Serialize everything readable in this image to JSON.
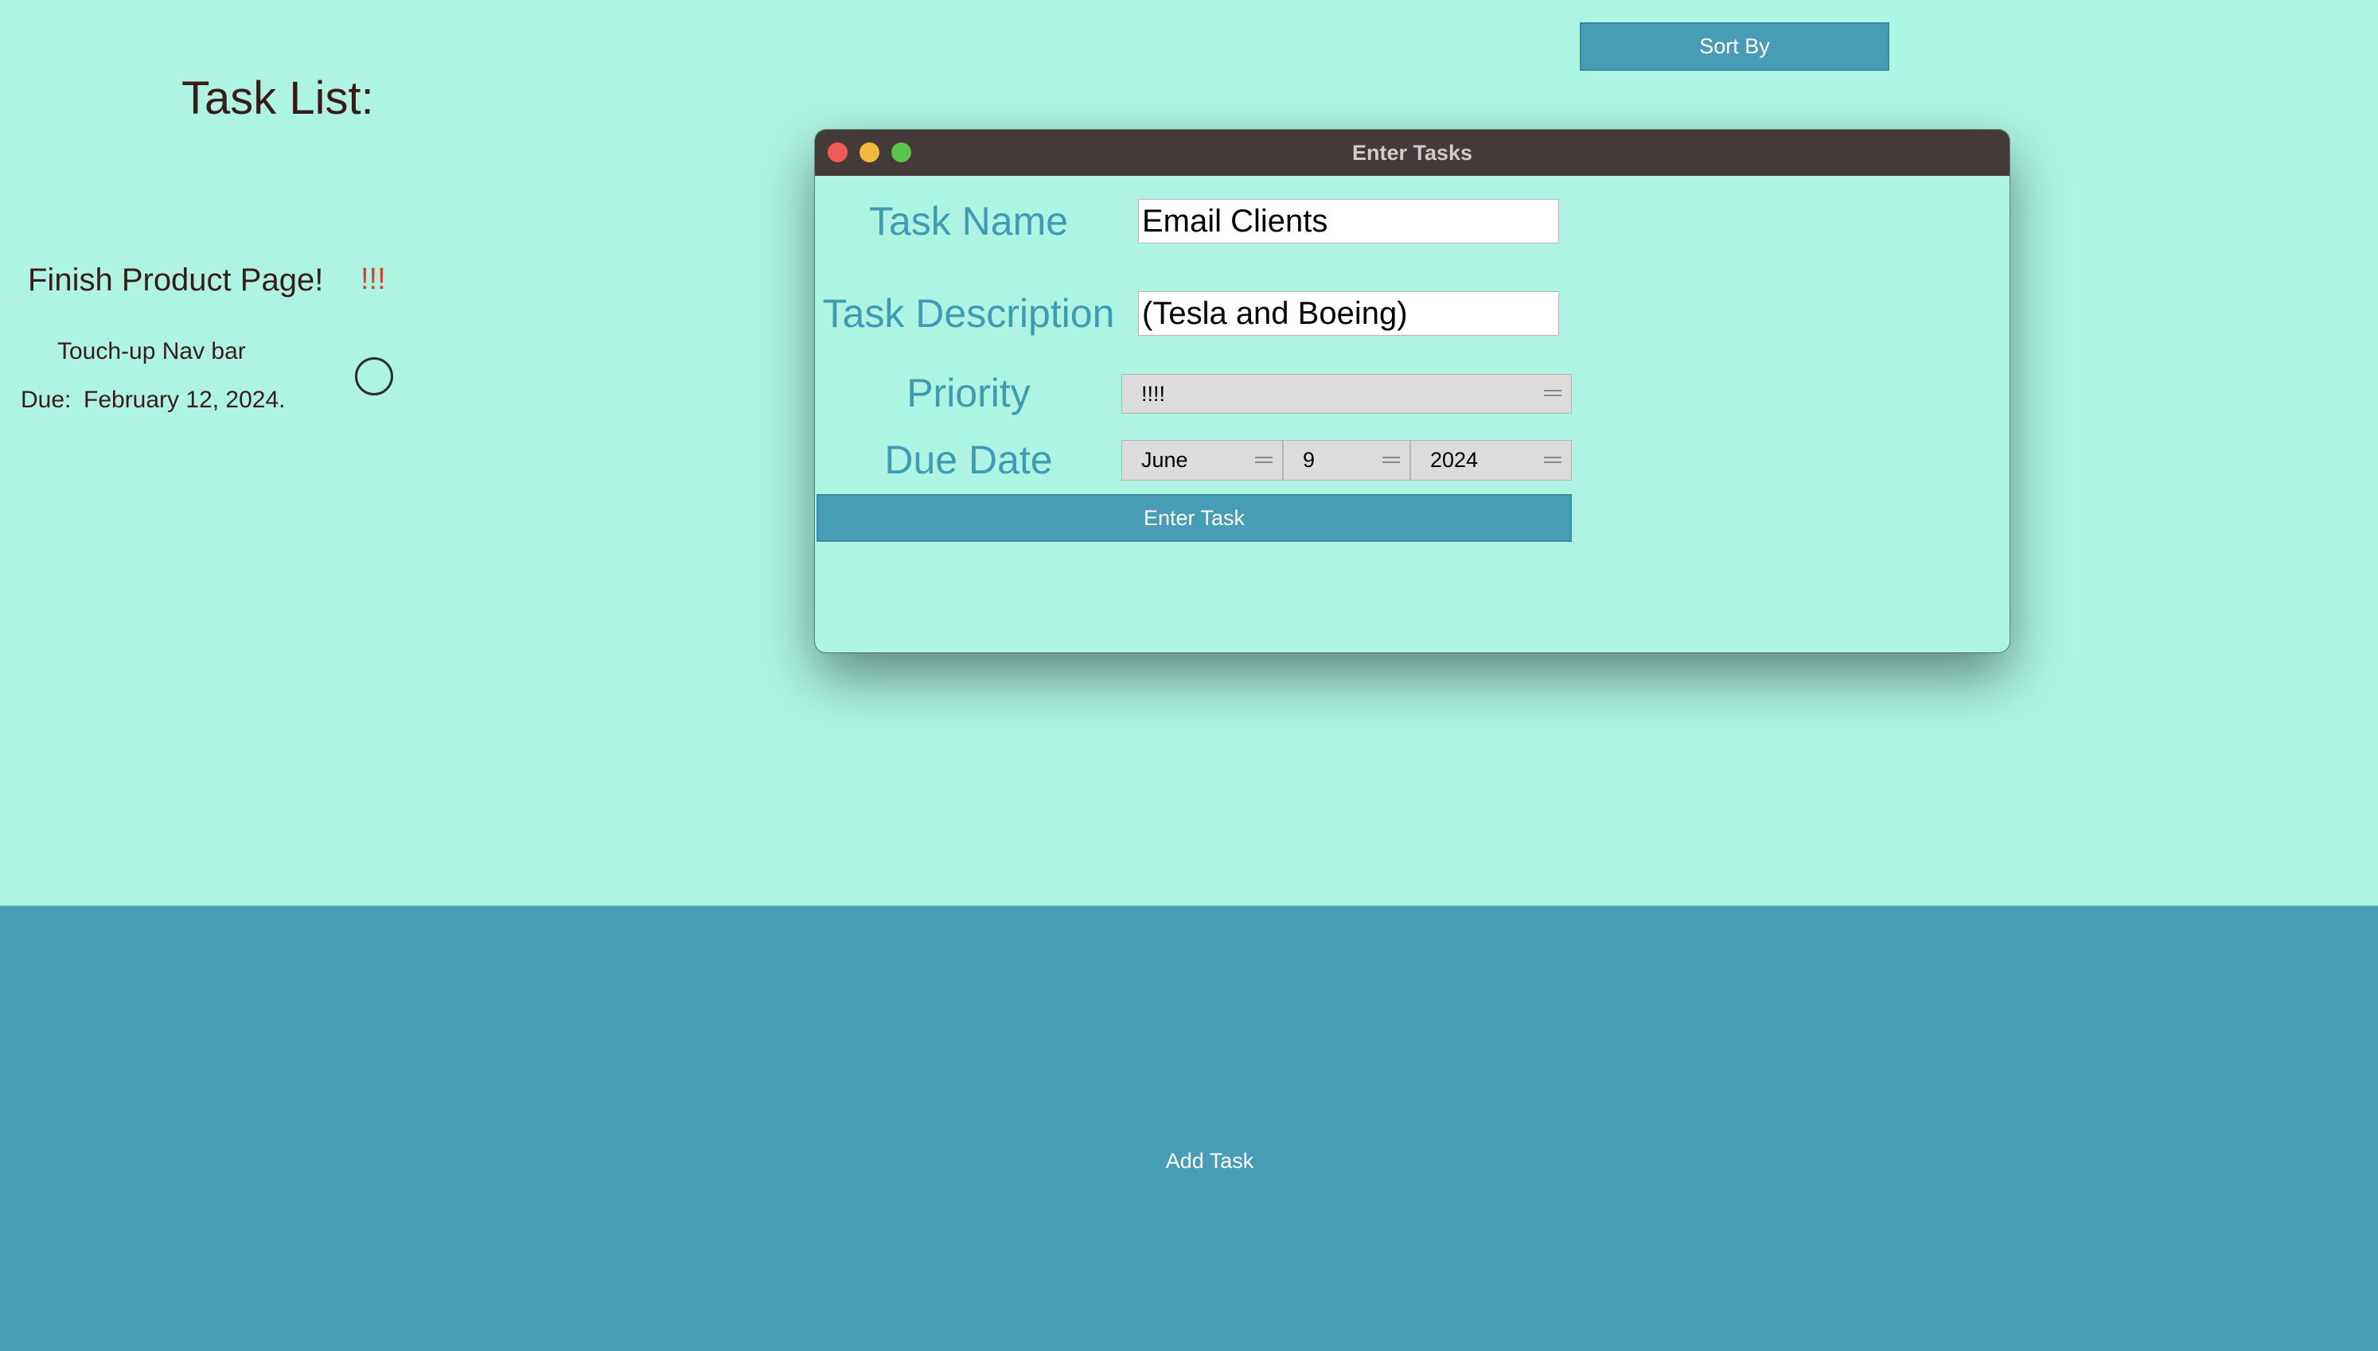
{
  "main": {
    "title": "Task List:",
    "sort_label": "Sort By",
    "add_task_label": "Add Task"
  },
  "tasks": [
    {
      "title": "Finish Product Page!",
      "priority": "!!!",
      "description": "Touch-up Nav bar",
      "due_label": "Due:",
      "due_date": "February 12, 2024."
    }
  ],
  "window": {
    "title": "Enter Tasks",
    "task_name_label": "Task Name",
    "task_name_value": "Email Clients",
    "task_desc_label": "Task Description",
    "task_desc_value": "(Tesla and Boeing)",
    "priority_label": "Priority",
    "priority_value": "!!!!",
    "due_date_label": "Due Date",
    "due_month": "June",
    "due_day": "9",
    "due_year": "2024",
    "enter_label": "Enter Task"
  },
  "colors": {
    "background": "#adf5e2",
    "accent": "#479db6",
    "label_text": "#3f9bb3",
    "priority_red": "#e03d28",
    "titlebar": "#443a3a"
  }
}
